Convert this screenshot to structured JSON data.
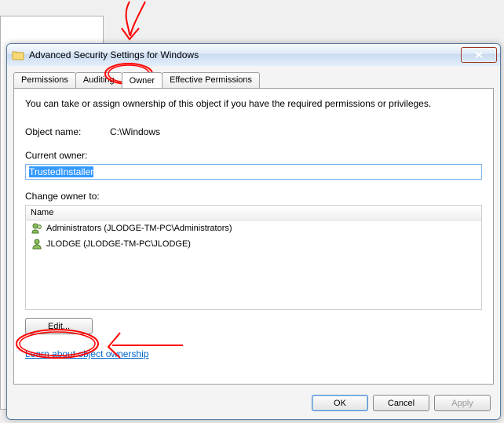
{
  "window": {
    "title": "Advanced Security Settings for Windows"
  },
  "tabs": {
    "t0": "Permissions",
    "t1": "Auditing",
    "t2": "Owner",
    "t3": "Effective Permissions"
  },
  "desc": "You can take or assign ownership of this object if you have the required permissions or privileges.",
  "object_name_label": "Object name:",
  "object_name_value": "C:\\Windows",
  "current_owner_label": "Current owner:",
  "current_owner_value": "TrustedInstaller",
  "change_owner_label": "Change owner to:",
  "list": {
    "header": "Name",
    "rows": [
      "Administrators (JLODGE-TM-PC\\Administrators)",
      "JLODGE (JLODGE-TM-PC\\JLODGE)"
    ]
  },
  "edit_button": "Edit...",
  "link": "Learn about object ownership",
  "buttons": {
    "ok": "OK",
    "cancel": "Cancel",
    "apply": "Apply"
  }
}
